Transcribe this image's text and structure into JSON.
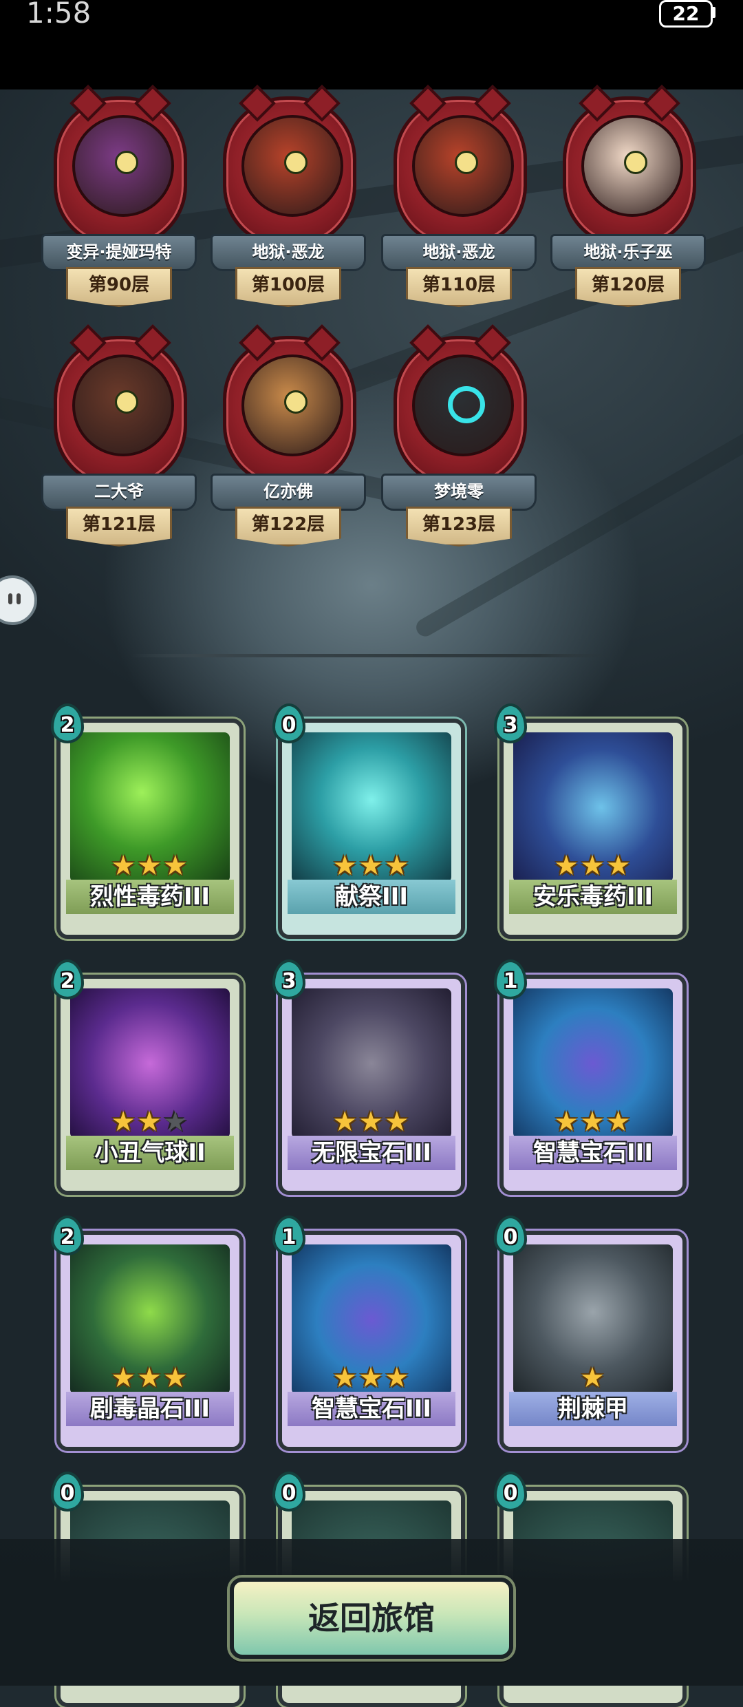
{
  "status_bar": {
    "time": "1:58",
    "battery": "22"
  },
  "bosses": [
    {
      "name": "变异·提娅玛特",
      "floor": "第90层",
      "portrait": "purple-dragon",
      "color": "#7c3b86"
    },
    {
      "name": "地狱·恶龙",
      "floor": "第100层",
      "portrait": "red-dragon",
      "color": "#b8432a"
    },
    {
      "name": "地狱·恶龙",
      "floor": "第110层",
      "portrait": "red-dragon",
      "color": "#b8432a"
    },
    {
      "name": "地狱·乐子巫",
      "floor": "第120层",
      "portrait": "curly-witch",
      "color": "#f1d9c7"
    },
    {
      "name": "二大爷",
      "floor": "第121层",
      "portrait": "barrel-s",
      "color": "#6a3a2a"
    },
    {
      "name": "亿亦佛",
      "floor": "第122层",
      "portrait": "one-eye-monk",
      "color": "#c98a4a"
    },
    {
      "name": "梦境零",
      "floor": "第123层",
      "portrait": "dark-orb",
      "color": "#2b3034"
    }
  ],
  "cards": [
    {
      "name": "烈性毒药III",
      "cost": "2",
      "stars": 3,
      "max_stars": 3,
      "theme": "green",
      "art": "poison-splash"
    },
    {
      "name": "献祭III",
      "cost": "0",
      "stars": 3,
      "max_stars": 3,
      "theme": "teal",
      "art": "sacrifice"
    },
    {
      "name": "安乐毒药III",
      "cost": "3",
      "stars": 3,
      "max_stars": 3,
      "theme": "green",
      "art": "poison-flask"
    },
    {
      "name": "小丑气球II",
      "cost": "2",
      "stars": 2,
      "max_stars": 3,
      "theme": "green",
      "art": "balloons"
    },
    {
      "name": "无限宝石III",
      "cost": "3",
      "stars": 3,
      "max_stars": 3,
      "theme": "purple",
      "art": "infinity-gem"
    },
    {
      "name": "智慧宝石III",
      "cost": "1",
      "stars": 3,
      "max_stars": 3,
      "theme": "purple",
      "art": "wisdom-gem"
    },
    {
      "name": "剧毒晶石III",
      "cost": "2",
      "stars": 3,
      "max_stars": 3,
      "theme": "purple",
      "art": "toxic-crystal"
    },
    {
      "name": "智慧宝石III",
      "cost": "1",
      "stars": 3,
      "max_stars": 3,
      "theme": "purple",
      "art": "wisdom-gem"
    },
    {
      "name": "荆棘甲",
      "cost": "0",
      "stars": 1,
      "max_stars": 1,
      "theme": "blue",
      "art": "thorn-armor"
    },
    {
      "name": "",
      "cost": "0",
      "stars": 0,
      "max_stars": 0,
      "theme": "green",
      "art": "partial"
    },
    {
      "name": "",
      "cost": "0",
      "stars": 0,
      "max_stars": 0,
      "theme": "green",
      "art": "partial"
    },
    {
      "name": "",
      "cost": "0",
      "stars": 0,
      "max_stars": 0,
      "theme": "green",
      "art": "partial"
    }
  ],
  "return_button": {
    "label": "返回旅馆"
  }
}
